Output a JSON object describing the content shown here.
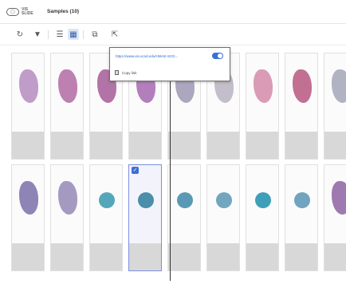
{
  "header": {
    "logo_text": "VIS SLIDE",
    "title": "Samples (10)"
  },
  "toolbar": {
    "buttons": [
      {
        "name": "refresh-icon",
        "glyph": "↻"
      },
      {
        "name": "filter-icon",
        "glyph": "▼"
      },
      {
        "name": "list-view-icon",
        "glyph": "☰"
      },
      {
        "name": "grid-view-icon",
        "glyph": "▦"
      },
      {
        "name": "link-icon",
        "glyph": "⧉"
      },
      {
        "name": "export-icon",
        "glyph": "⇱"
      }
    ]
  },
  "popup": {
    "url": "https://www.vis.ucsd.edu/HMAE-SCD...",
    "copy_label": "Copy link",
    "toggle_on": true
  },
  "grid": {
    "row1": [
      {
        "color": "#b58bbf"
      },
      {
        "color": "#b06aa3"
      },
      {
        "color": "#a55a98"
      },
      {
        "color": "#a568b0"
      },
      {
        "color": "#9e97b3"
      },
      {
        "color": "#b9b3bf"
      },
      {
        "color": "#d48aa9"
      },
      {
        "color": "#b7577f"
      },
      {
        "color": "#a3a5b7"
      }
    ],
    "row2": [
      {
        "color": "#7b6fa9"
      },
      {
        "color": "#9488b6"
      },
      {
        "color": "#54a7b8"
      },
      {
        "color": "#4a8ea9",
        "selected": true
      },
      {
        "color": "#5a99b5"
      },
      {
        "color": "#72a6c0"
      },
      {
        "color": "#3f9fb8"
      },
      {
        "color": "#72a3bf"
      },
      {
        "color": "#8d63a2"
      }
    ]
  },
  "colors": {
    "accent": "#3c6fd6",
    "selection_border": "#7d8de6",
    "label_bg": "#d8d8d8"
  }
}
